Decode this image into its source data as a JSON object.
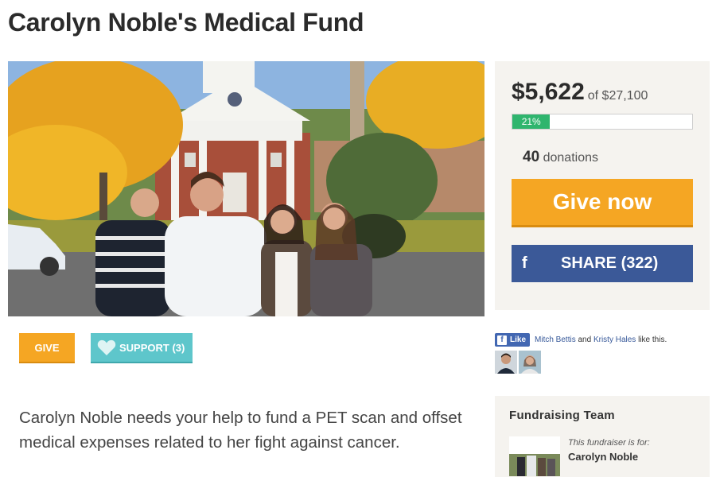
{
  "page": {
    "title": "Carolyn Noble's Medical Fund"
  },
  "donation": {
    "raised": "$5,622",
    "goal_text": "of $27,100",
    "progress_label": "21%",
    "progress_fraction": 0.21,
    "donations_count": "40",
    "donations_label": "donations",
    "give_now_label": "Give now",
    "share_icon": "f",
    "share_label": "SHARE (322)"
  },
  "actions": {
    "give_label": "GIVE",
    "support_label": "SUPPORT (3)"
  },
  "facebook": {
    "like_button": "Like",
    "friend1": "Mitch Bettis",
    "and": "and",
    "friend2": "Kristy Hales",
    "suffix": "like this."
  },
  "description": "Carolyn Noble needs your help to fund a PET scan and offset medical expenses related to her fight against cancer.",
  "team": {
    "title": "Fundraising Team",
    "for_label": "This fundraiser is for:",
    "name": "Carolyn Noble"
  },
  "colors": {
    "orange": "#f5a623",
    "green": "#2fb56e",
    "facebook_blue": "#3b5998",
    "teal": "#5ec6cb",
    "panel_bg": "#f5f3ef"
  },
  "icons": {
    "heart": "heart-icon",
    "facebook": "facebook-icon"
  }
}
